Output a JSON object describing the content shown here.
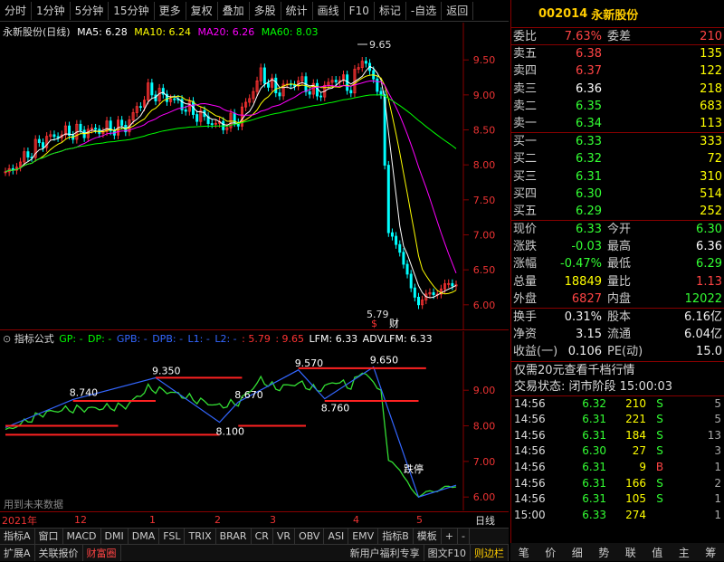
{
  "topbar": {
    "items": [
      "分时",
      "1分钟",
      "5分钟",
      "15分钟",
      "更多",
      "复权",
      "叠加",
      "多股",
      "统计",
      "画线",
      "F10",
      "标记",
      "-自选",
      "返回"
    ]
  },
  "main": {
    "title": "永新股份(日线)",
    "ma": [
      {
        "label": "MA5: 6.28",
        "color": "#ffffff"
      },
      {
        "label": "MA10: 6.24",
        "color": "#ffff00"
      },
      {
        "label": "MA20: 6.26",
        "color": "#ff00ff"
      },
      {
        "label": "MA60: 8.03",
        "color": "#00ff00"
      }
    ],
    "y_ticks": [
      "9.50",
      "9.00",
      "8.50",
      "8.00",
      "7.50",
      "7.00",
      "6.50",
      "6.00"
    ],
    "high_label": "9.65",
    "low_label": "5.79",
    "mark_label": "财"
  },
  "sub": {
    "title": "指标公式",
    "legend": [
      {
        "label": "GP: -",
        "color": "#00ff00"
      },
      {
        "label": "DP: -",
        "color": "#00ff00"
      },
      {
        "label": "GPB: -",
        "color": "#3366ff"
      },
      {
        "label": "DPB: -",
        "color": "#3366ff"
      },
      {
        "label": "L1: -",
        "color": "#3366ff"
      },
      {
        "label": "L2: -",
        "color": "#3366ff"
      },
      {
        "label": ": 5.79",
        "color": "#ff3333"
      },
      {
        "label": ": 9.65",
        "color": "#ff3333"
      },
      {
        "label": "LFM: 6.33",
        "color": "#ffffff"
      },
      {
        "label": "ADVLFM: 6.33",
        "color": "#ffffff"
      }
    ],
    "y_ticks": [
      "9.00",
      "8.00",
      "7.00",
      "6.00"
    ],
    "annotations": [
      "9.350",
      "8.740",
      "8.670",
      "9.570",
      "9.650",
      "8.760",
      "8.100",
      "跌停"
    ],
    "watermark": "用到未来数据"
  },
  "time_axis": {
    "labels": [
      "2021年",
      "12",
      "1",
      "2",
      "3",
      "4",
      "5"
    ],
    "right_label": "日线"
  },
  "tabs": [
    "指标A",
    "窗口",
    "MACD",
    "DMI",
    "DMA",
    "FSL",
    "TRIX",
    "BRAR",
    "CR",
    "VR",
    "OBV",
    "ASI",
    "EMV",
    "指标B",
    "模板",
    "+",
    "-"
  ],
  "tabs2": [
    "扩展A",
    "关联报价",
    "财富圈"
  ],
  "tabs2_right": [
    "新用户福利专享",
    "图文F10",
    "则边栏"
  ],
  "quote": {
    "code": "002014",
    "name": "永新股份",
    "webi": {
      "label": "委比",
      "value": "7.63%",
      "label2": "委差",
      "value2": "210"
    },
    "sell": [
      {
        "label": "卖五",
        "price": "6.38",
        "vol": "135",
        "pcolor": "#ff4444"
      },
      {
        "label": "卖四",
        "price": "6.37",
        "vol": "122",
        "pcolor": "#ff4444"
      },
      {
        "label": "卖三",
        "price": "6.36",
        "vol": "218",
        "pcolor": "#ffffff"
      },
      {
        "label": "卖二",
        "price": "6.35",
        "vol": "683",
        "pcolor": "#33ff33"
      },
      {
        "label": "卖一",
        "price": "6.34",
        "vol": "113",
        "pcolor": "#33ff33"
      }
    ],
    "buy": [
      {
        "label": "买一",
        "price": "6.33",
        "vol": "333",
        "pcolor": "#33ff33"
      },
      {
        "label": "买二",
        "price": "6.32",
        "vol": "72",
        "pcolor": "#33ff33"
      },
      {
        "label": "买三",
        "price": "6.31",
        "vol": "310",
        "pcolor": "#33ff33"
      },
      {
        "label": "买四",
        "price": "6.30",
        "vol": "514",
        "pcolor": "#33ff33"
      },
      {
        "label": "买五",
        "price": "6.29",
        "vol": "252",
        "pcolor": "#33ff33"
      }
    ],
    "stats": [
      {
        "l1": "现价",
        "v1": "6.33",
        "c1": "#33ff33",
        "l2": "今开",
        "v2": "6.30",
        "c2": "#33ff33"
      },
      {
        "l1": "涨跌",
        "v1": "-0.03",
        "c1": "#33ff33",
        "l2": "最高",
        "v2": "6.36",
        "c2": "#ffffff"
      },
      {
        "l1": "涨幅",
        "v1": "-0.47%",
        "c1": "#33ff33",
        "l2": "最低",
        "v2": "6.29",
        "c2": "#33ff33"
      },
      {
        "l1": "总量",
        "v1": "18849",
        "c1": "#ffff00",
        "l2": "量比",
        "v2": "1.13",
        "c2": "#ff4444"
      },
      {
        "l1": "外盘",
        "v1": "6827",
        "c1": "#ff4444",
        "l2": "内盘",
        "v2": "12022",
        "c2": "#33ff33"
      }
    ],
    "stats2": [
      {
        "l1": "换手",
        "v1": "0.31%",
        "l2": "股本",
        "v2": "6.16亿"
      },
      {
        "l1": "净资",
        "v1": "3.15",
        "l2": "流通",
        "v2": "6.04亿"
      },
      {
        "l1": "收益(一)",
        "v1": "0.106",
        "l2": "PE(动)",
        "v2": "15.0"
      }
    ],
    "promo": "仅需20元查看千档行情",
    "status": "交易状态: 闭市阶段 15:00:03",
    "trades": [
      {
        "t": "14:56",
        "p": "6.32",
        "v": "210",
        "d": "S",
        "n": "5"
      },
      {
        "t": "14:56",
        "p": "6.31",
        "v": "221",
        "d": "S",
        "n": "5"
      },
      {
        "t": "14:56",
        "p": "6.31",
        "v": "184",
        "d": "S",
        "n": "13"
      },
      {
        "t": "14:56",
        "p": "6.30",
        "v": "27",
        "d": "S",
        "n": "3"
      },
      {
        "t": "14:56",
        "p": "6.31",
        "v": "9",
        "d": "B",
        "n": "1"
      },
      {
        "t": "14:56",
        "p": "6.31",
        "v": "166",
        "d": "S",
        "n": "2"
      },
      {
        "t": "14:56",
        "p": "6.31",
        "v": "105",
        "d": "S",
        "n": "1"
      },
      {
        "t": "15:00",
        "p": "6.33",
        "v": "274",
        "d": "",
        "n": "1"
      }
    ]
  },
  "bottomnav": [
    "笔",
    "价",
    "细",
    "势",
    "联",
    "值",
    "主",
    "筹"
  ]
}
